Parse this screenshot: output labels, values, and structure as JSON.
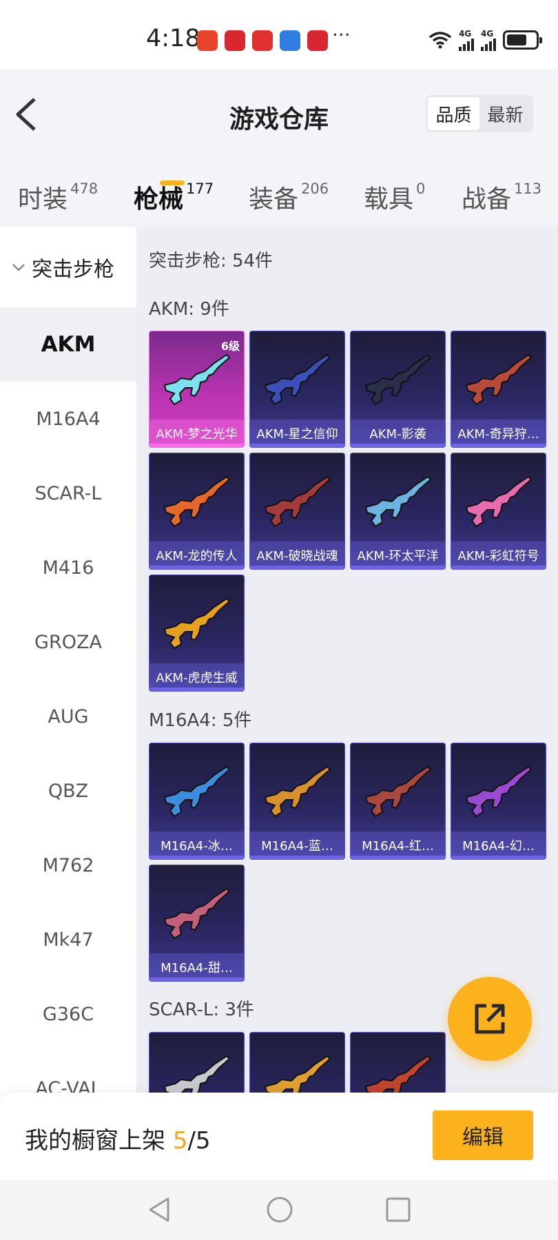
{
  "status_bar": {
    "time": "4:18",
    "signal_label": "4G",
    "app_icon_colors": [
      "#e8432b",
      "#d9262f",
      "#e0312e",
      "#2f7de1",
      "#d9262f"
    ]
  },
  "header": {
    "title": "游戏仓库",
    "sort_options": [
      "品质",
      "最新"
    ],
    "tabs": [
      {
        "label": "时装",
        "count": "478"
      },
      {
        "label": "枪械",
        "count": "177"
      },
      {
        "label": "装备",
        "count": "206"
      },
      {
        "label": "载具",
        "count": "0"
      },
      {
        "label": "战备",
        "count": "113"
      }
    ]
  },
  "sidebar": {
    "category": "突击步枪",
    "items": [
      "AKM",
      "M16A4",
      "SCAR-L",
      "M416",
      "GROZA",
      "AUG",
      "QBZ",
      "M762",
      "Mk47",
      "G36C",
      "AC-VAL"
    ]
  },
  "content": {
    "category_title": "突击步枪: 54件",
    "groups": [
      {
        "title": "AKM: 9件",
        "items": [
          {
            "name": "AKM-梦之光华",
            "level": "6级",
            "style": "pink",
            "gun_color": "#7de0f0"
          },
          {
            "name": "AKM-星之信仰",
            "level": "",
            "style": "purple",
            "gun_color": "#3b4fb8"
          },
          {
            "name": "AKM-影袭",
            "level": "",
            "style": "purple",
            "gun_color": "#2a2f4a"
          },
          {
            "name": "AKM-奇异狩…",
            "level": "",
            "style": "purple",
            "gun_color": "#b84a3a"
          },
          {
            "name": "AKM-龙的传人",
            "level": "",
            "style": "purple",
            "gun_color": "#e3682a"
          },
          {
            "name": "AKM-破晓战魂",
            "level": "",
            "style": "purple",
            "gun_color": "#a43b3b"
          },
          {
            "name": "AKM-环太平洋",
            "level": "",
            "style": "purple",
            "gun_color": "#6cb4e0"
          },
          {
            "name": "AKM-彩虹符号",
            "level": "",
            "style": "purple",
            "gun_color": "#e86bb0"
          },
          {
            "name": "AKM-虎虎生威",
            "level": "",
            "style": "purple",
            "gun_color": "#e6a020"
          }
        ]
      },
      {
        "title": "M16A4: 5件",
        "items": [
          {
            "name": "M16A4-冰…",
            "level": "",
            "style": "purple",
            "gun_color": "#3c8de0"
          },
          {
            "name": "M16A4-蓝…",
            "level": "",
            "style": "purple",
            "gun_color": "#d9902a"
          },
          {
            "name": "M16A4-红…",
            "level": "",
            "style": "purple",
            "gun_color": "#a8483e"
          },
          {
            "name": "M16A4-幻…",
            "level": "",
            "style": "purple",
            "gun_color": "#9a4ad0"
          },
          {
            "name": "M16A4-甜…",
            "level": "",
            "style": "purple",
            "gun_color": "#c0607a"
          }
        ]
      },
      {
        "title": "SCAR-L: 3件",
        "items": [
          {
            "name": "",
            "level": "",
            "style": "purple",
            "gun_color": "#c8c8d0"
          },
          {
            "name": "",
            "level": "",
            "style": "purple",
            "gun_color": "#e0a030"
          },
          {
            "name": "",
            "level": "",
            "style": "purple",
            "gun_color": "#c0442e"
          }
        ]
      }
    ]
  },
  "bottom_bar": {
    "showcase_label": "我的橱窗上架 ",
    "showcase_current": "5",
    "showcase_total": "/5",
    "edit_label": "编辑"
  },
  "colors": {
    "accent": "#fcb21c",
    "card_purple": "#2a2660",
    "card_pink": "#b934b0"
  }
}
